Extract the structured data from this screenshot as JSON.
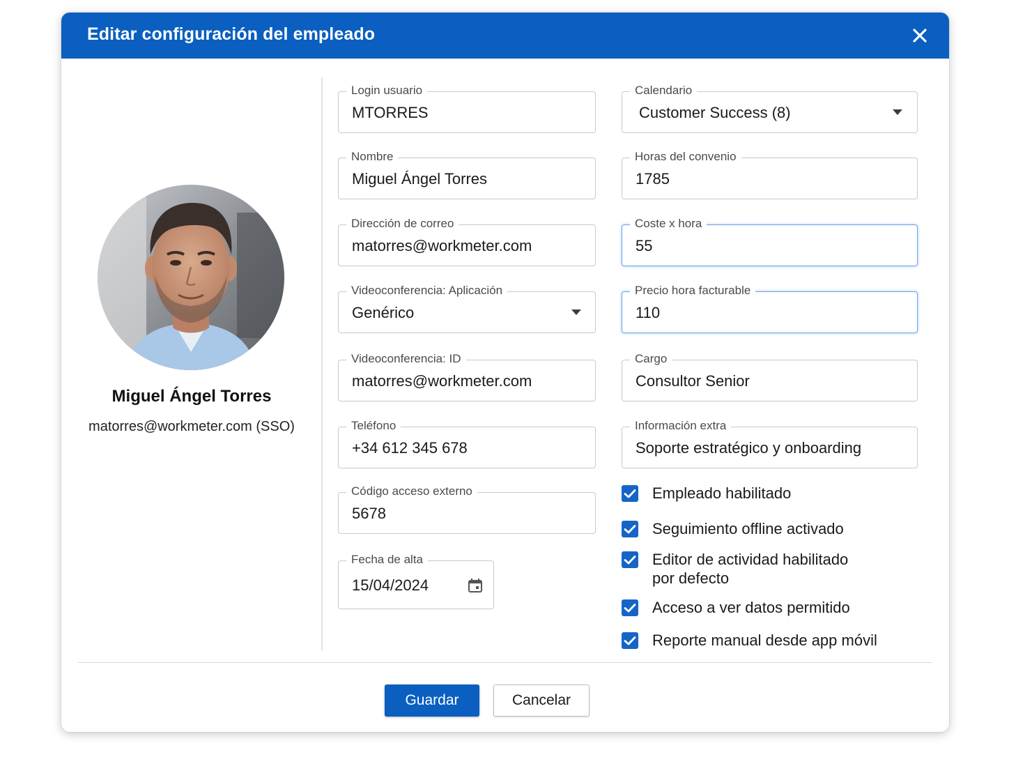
{
  "dialog": {
    "title": "Editar configuración del empleado",
    "close_icon": "close-icon"
  },
  "profile": {
    "name": "Miguel Ángel Torres",
    "email": "matorres@workmeter.com (SSO)",
    "avatar_icon": "avatar-photo"
  },
  "fields": {
    "login": {
      "label": "Login usuario",
      "value": "MTORRES"
    },
    "nombre": {
      "label": "Nombre",
      "value": "Miguel Ángel Torres"
    },
    "correo": {
      "label": "Dirección de correo",
      "value": "matorres@workmeter.com"
    },
    "video_app": {
      "label": "Videoconferencia: Aplicación",
      "value": "Genérico"
    },
    "video_id": {
      "label": "Videoconferencia: ID",
      "value": "matorres@workmeter.com"
    },
    "telefono": {
      "label": "Teléfono",
      "value": "+34 612 345 678"
    },
    "codigo": {
      "label": "Código acceso externo",
      "value": "5678"
    },
    "fecha": {
      "label": "Fecha de alta",
      "value": "15/04/2024"
    },
    "calendario": {
      "label": "Calendario",
      "value": "Customer Success (8)"
    },
    "horas": {
      "label": "Horas del convenio",
      "value": "1785"
    },
    "coste": {
      "label": "Coste x hora",
      "value": "55"
    },
    "precio": {
      "label": "Precio hora facturable",
      "value": "110"
    },
    "cargo": {
      "label": "Cargo",
      "value": "Consultor Senior"
    },
    "info": {
      "label": "Información extra",
      "value": "Soporte estratégico y onboarding"
    }
  },
  "checkboxes": [
    {
      "label": "Empleado habilitado",
      "checked": true
    },
    {
      "label": "Seguimiento offline activado",
      "checked": true
    },
    {
      "label": "Editor de actividad habilitado por defecto",
      "checked": true
    },
    {
      "label": "Acceso a ver datos permitido",
      "checked": true
    },
    {
      "label": "Reporte manual desde app móvil",
      "checked": true
    }
  ],
  "buttons": {
    "save": "Guardar",
    "cancel": "Cancelar"
  },
  "colors": {
    "header": "#0a5fc0",
    "primary_button": "#0a5fc0",
    "checkbox": "#1565c8",
    "focus_border": "#6fa3e6"
  }
}
